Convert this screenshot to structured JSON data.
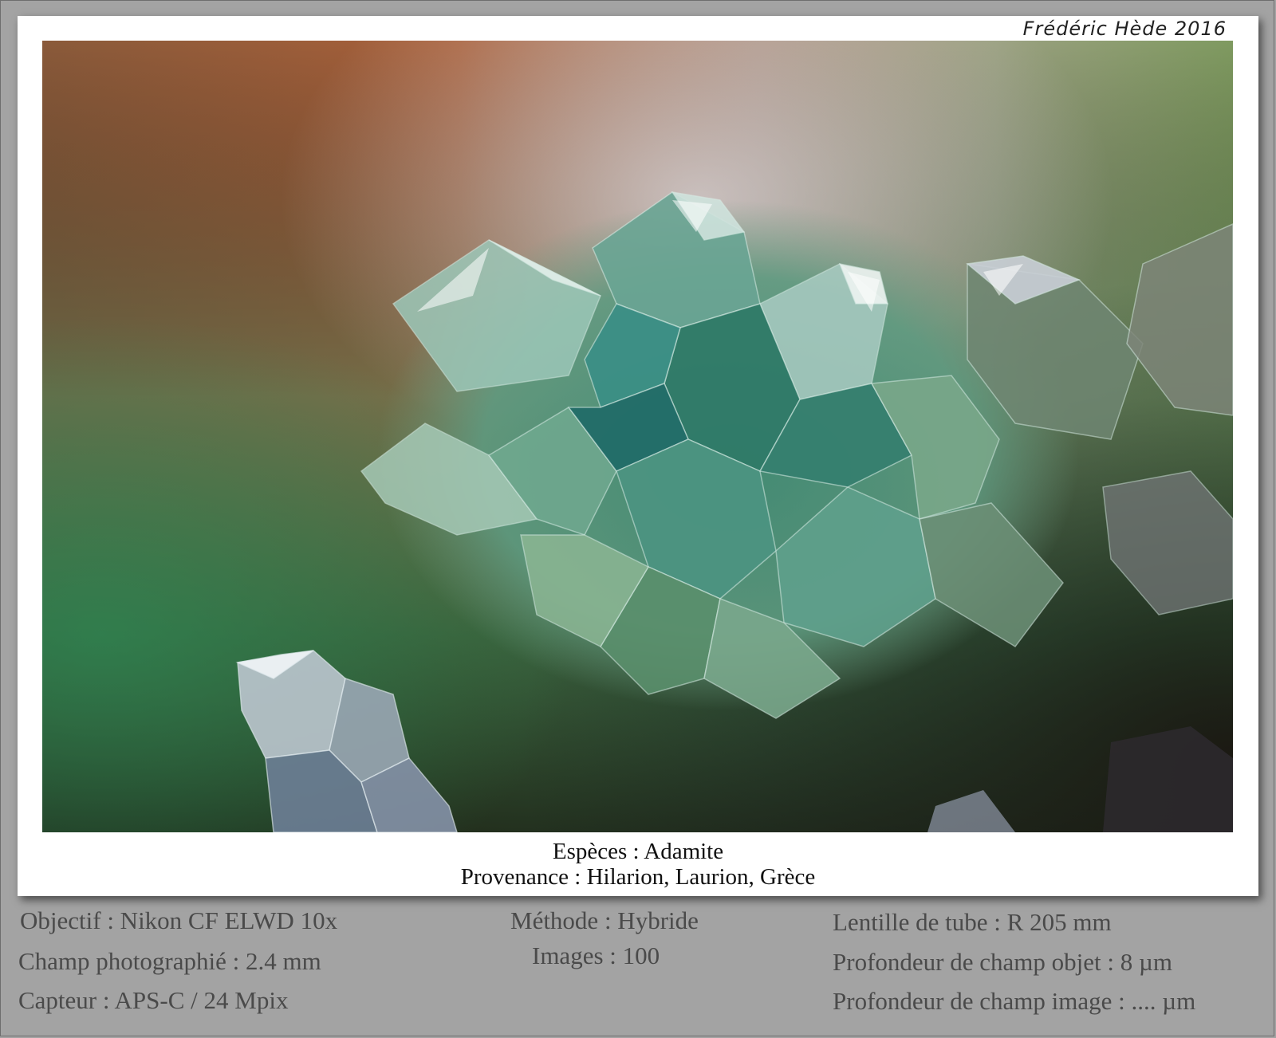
{
  "signature": "Frédéric Hède 2016",
  "caption": {
    "species": "Espèces : Adamite",
    "origin": "Provenance : Hilarion, Laurion, Grèce"
  },
  "specs": {
    "objective": "Objectif : Nikon CF ELWD 10x",
    "field": "Champ photographié : 2.4 mm",
    "sensor": "Capteur : APS-C / 24 Mpix",
    "method": "Méthode : Hybride",
    "images": "Images : 100",
    "tube_lens": "Lentille de tube : R 205 mm",
    "dof_object": "Profondeur de champ objet : 8 µm",
    "dof_image": "Profondeur de champ image : .... µm"
  },
  "colors": {
    "background": "#a3a3a3",
    "card": "#ffffff",
    "crystal_green": "#2f7a68",
    "rust_orange": "#b0603a"
  }
}
